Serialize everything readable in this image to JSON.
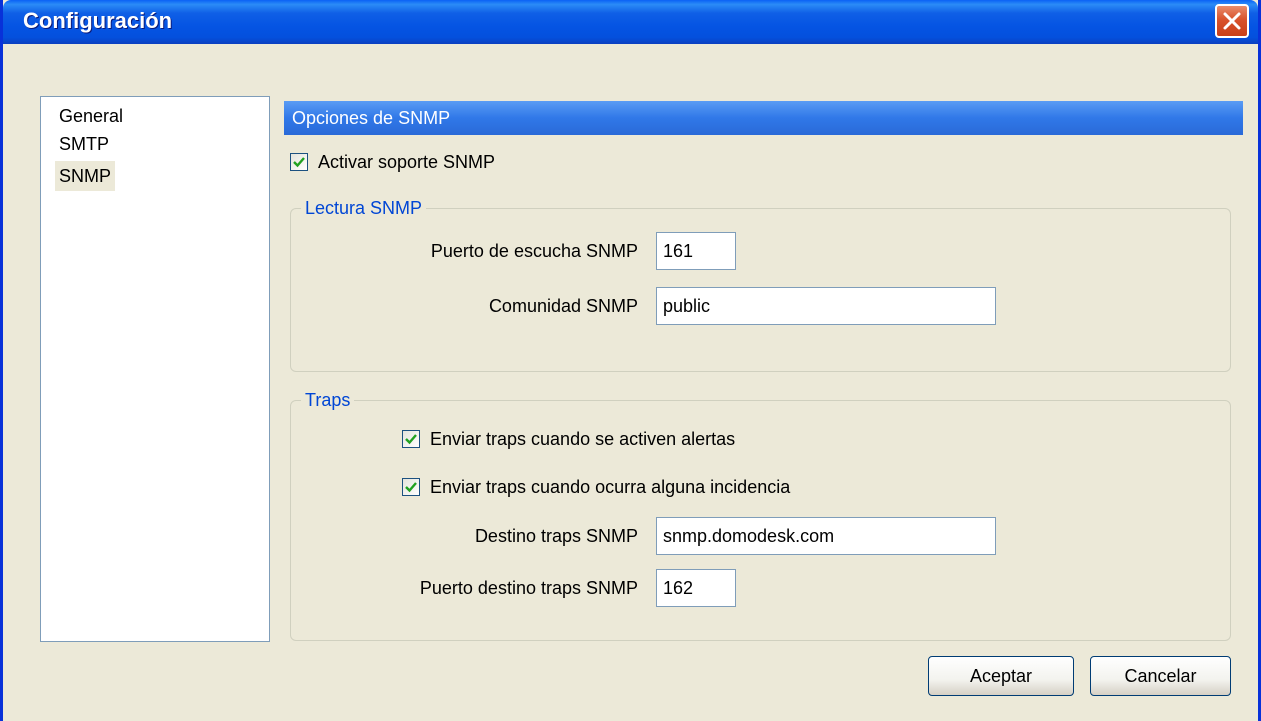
{
  "window": {
    "title": "Configuración"
  },
  "nav": {
    "items": [
      {
        "label": "General"
      },
      {
        "label": "SMTP"
      },
      {
        "label": "SNMP"
      }
    ],
    "selected": "SNMP"
  },
  "panel": {
    "header": "Opciones de SNMP",
    "enable_snmp": {
      "label": "Activar soporte SNMP",
      "checked": true
    },
    "read_group": {
      "legend": "Lectura SNMP",
      "port_label": "Puerto de escucha SNMP",
      "port_value": "161",
      "community_label": "Comunidad SNMP",
      "community_value": "public"
    },
    "traps_group": {
      "legend": "Traps",
      "alerts": {
        "label": "Enviar traps cuando se activen alertas",
        "checked": true
      },
      "incidents": {
        "label": "Enviar traps cuando ocurra alguna incidencia",
        "checked": true
      },
      "dest_label": "Destino traps SNMP",
      "dest_value": "snmp.domodesk.com",
      "dest_port_label": "Puerto destino traps SNMP",
      "dest_port_value": "162"
    }
  },
  "buttons": {
    "accept": "Aceptar",
    "cancel": "Cancelar"
  },
  "colors": {
    "titlebar": "#0554e3",
    "section_header": "#3078e8",
    "legend_text": "#0046d5",
    "checkmark": "#21a121",
    "dialog_bg": "#ece9d8"
  }
}
